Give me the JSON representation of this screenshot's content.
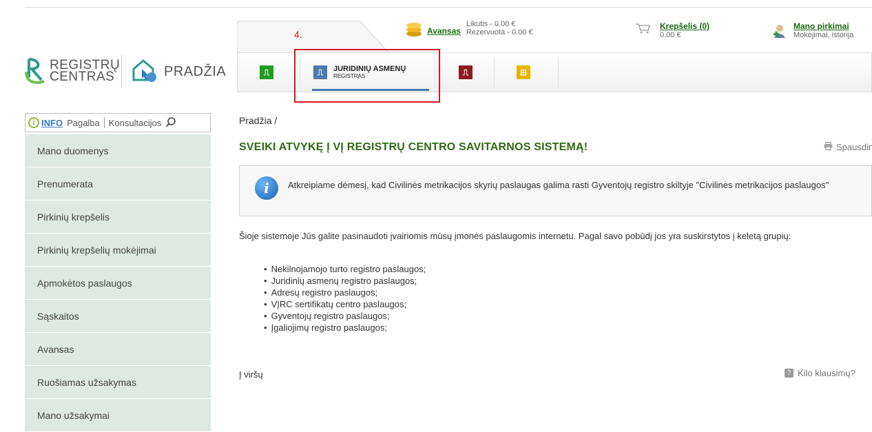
{
  "header": {
    "step_marker": "4.",
    "avansas": {
      "link": "Avansas",
      "likutis": "Likutis - 0.00 €",
      "rezervuota": "Rezervuota - 0.00 €"
    },
    "cart": {
      "link": "Krepšelis (0)",
      "amount": "0.00 €"
    },
    "purchases": {
      "link": "Mano pirkimai",
      "sub": "Mokėjimai, istorija"
    }
  },
  "logos": {
    "rc_line1": "REGISTRŲ",
    "rc_line2": "CENTRAS",
    "home": "PRADŽIA"
  },
  "registers": {
    "active_title": "JURIDINIŲ ASMENŲ",
    "active_sub": "REGISTRAS",
    "icons": [
      "green-register-icon",
      "blue-register-icon",
      "maroon-register-icon",
      "yellow-register-icon"
    ],
    "colors": {
      "green": "#1f9b1f",
      "blue": "#4a79b0",
      "maroon": "#8b1c24",
      "yellow": "#e8b400"
    }
  },
  "info_bar": {
    "info": "INFO",
    "help": "Pagalba",
    "consult": "Konsultacijos"
  },
  "sidebar": {
    "items": [
      {
        "label": "Mano duomenys"
      },
      {
        "label": "Prenumerata"
      },
      {
        "label": "Pirkinių krepšelis"
      },
      {
        "label": "Pirkinių krepšelių mokėjimai"
      },
      {
        "label": "Apmokėtos paslaugos"
      },
      {
        "label": "Sąskaitos"
      },
      {
        "label": "Avansas"
      },
      {
        "label": "Ruošiamas užsakymas"
      },
      {
        "label": "Mano užsakymai"
      }
    ]
  },
  "main": {
    "breadcrumb": "Pradžia /",
    "title": "SVEIKI ATVYKĘ Į VĮ REGISTRŲ CENTRO SAVITARNOS SISTEMĄ!",
    "print": "Spausdinti",
    "notice": "Atkreipiame dėmesį, kad Civilinės metrikacijos skyrių paslaugas galima rasti Gyventojų registro skiltyje \"Civilinės metrikacijos paslaugos\"",
    "intro": "Šioje sistemoje Jūs galite pasinaudoti įvairiomis mūsų įmonės paslaugomis internetu. Pagal savo pobūdį jos yra suskirstytos į keletą grupių:",
    "services": [
      "Nekilnojamojo turto registro paslaugos;",
      "Juridinių asmenų registro paslaugos;",
      "Adresų registro paslaugos;",
      "VĮRC sertifikatų centro paslaugos;",
      "Gyventojų registro paslaugos;",
      "Įgaliojimų registro paslaugos;"
    ],
    "to_top": "Į viršų",
    "questions": "Kilo klausimų?"
  }
}
